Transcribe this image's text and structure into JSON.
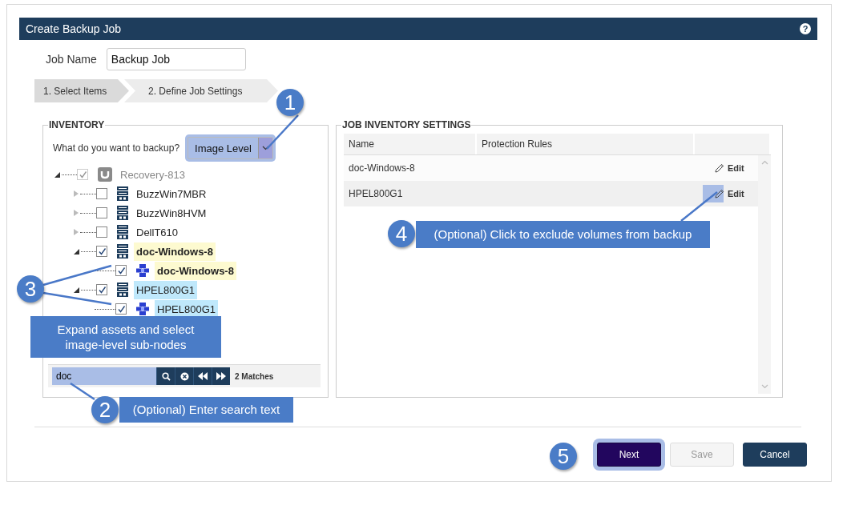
{
  "dialog": {
    "title": "Create Backup Job",
    "help_icon": "?"
  },
  "job_name": {
    "label": "Job Name",
    "value": "Backup Job"
  },
  "steps": [
    {
      "label": "1. Select Items",
      "selected": true
    },
    {
      "label": "2. Define Job Settings",
      "selected": false
    }
  ],
  "inventory": {
    "legend": "INVENTORY",
    "question": "What do you want to backup?",
    "backup_type": {
      "value": "Image Level",
      "highlighted": true
    },
    "tree": [
      {
        "label": "Recovery-813",
        "kind": "appliance",
        "checked": true,
        "disabled": true,
        "matched": false,
        "selected": false,
        "expanded": true,
        "children": [
          {
            "label": "BuzzWin7MBR",
            "kind": "server",
            "checked": false,
            "disabled": false,
            "matched": false,
            "selected": false,
            "expanded": false
          },
          {
            "label": "BuzzWin8HVM",
            "kind": "server",
            "checked": false,
            "disabled": false,
            "matched": false,
            "selected": false,
            "expanded": false
          },
          {
            "label": "DellT610",
            "kind": "server",
            "checked": false,
            "disabled": false,
            "matched": false,
            "selected": false,
            "expanded": false
          },
          {
            "label": "doc-Windows-8",
            "kind": "server",
            "checked": true,
            "disabled": false,
            "matched": true,
            "selected": false,
            "expanded": true,
            "children": [
              {
                "label": "doc-Windows-8",
                "kind": "image",
                "checked": true,
                "disabled": false,
                "matched": true,
                "selected": false
              }
            ]
          },
          {
            "label": "HPEL800G1",
            "kind": "server",
            "checked": true,
            "disabled": false,
            "matched": false,
            "selected": true,
            "expanded": true,
            "children": [
              {
                "label": "HPEL800G1",
                "kind": "image",
                "checked": true,
                "disabled": false,
                "matched": false,
                "selected": true
              }
            ]
          }
        ]
      }
    ],
    "search": {
      "value": "doc",
      "highlighted": true,
      "matches": "2 Matches"
    }
  },
  "job_inventory": {
    "legend": "JOB INVENTORY SETTINGS",
    "columns": [
      "Name",
      "Protection Rules"
    ],
    "rows": [
      {
        "name": "doc-Windows-8",
        "action": "Edit",
        "highlighted": false
      },
      {
        "name": "HPEL800G1",
        "action": "Edit",
        "highlighted": true
      }
    ]
  },
  "buttons": [
    {
      "label": "Next",
      "kind": "primary",
      "disabled": false,
      "highlighted": true
    },
    {
      "label": "Save",
      "kind": "secondary",
      "disabled": true,
      "highlighted": false
    },
    {
      "label": "Cancel",
      "kind": "cancel",
      "disabled": false,
      "highlighted": false
    }
  ],
  "callouts": [
    {
      "number": "1"
    },
    {
      "number": "2",
      "text": "(Optional) Enter search text"
    },
    {
      "number": "3",
      "text": "Expand assets and select image-level sub-nodes"
    },
    {
      "number": "4",
      "text": "(Optional) Click to exclude volumes from backup"
    },
    {
      "number": "5"
    }
  ]
}
